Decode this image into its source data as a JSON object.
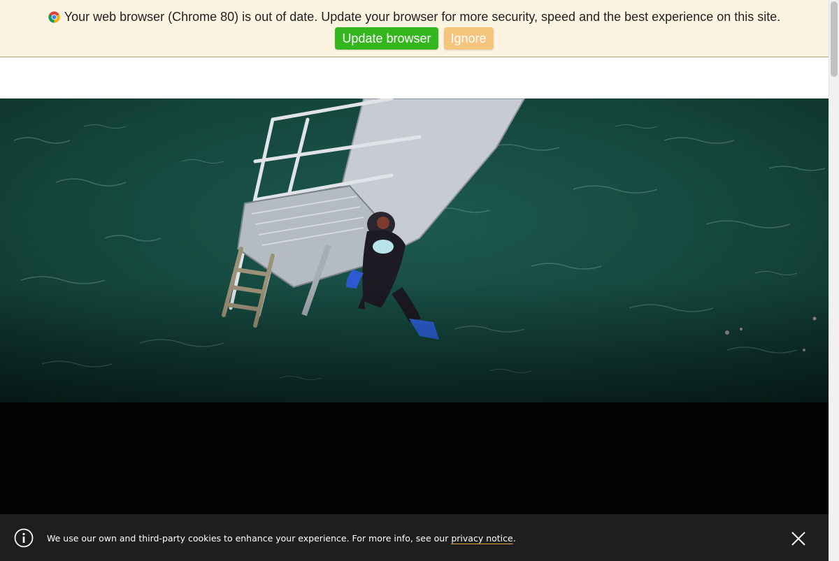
{
  "banner": {
    "message": "Your web browser (Chrome 80) is out of date. Update your browser for more security, speed and the best experience on this site.",
    "update_label": "Update browser",
    "ignore_label": "Ignore",
    "icon": "chrome-logo-icon",
    "colors": {
      "background": "#fdf3e1",
      "update": "#33b61e",
      "ignore": "#f5c57e"
    }
  },
  "hero": {
    "image": "diver-descending-ladder-into-sea-photo"
  },
  "cookie": {
    "text": "We use our own and third-party cookies to enhance your experience. For more info, see our ",
    "link_label": "privacy notice",
    "suffix": ".",
    "info_icon": "info-icon",
    "close_icon": "close-icon"
  }
}
